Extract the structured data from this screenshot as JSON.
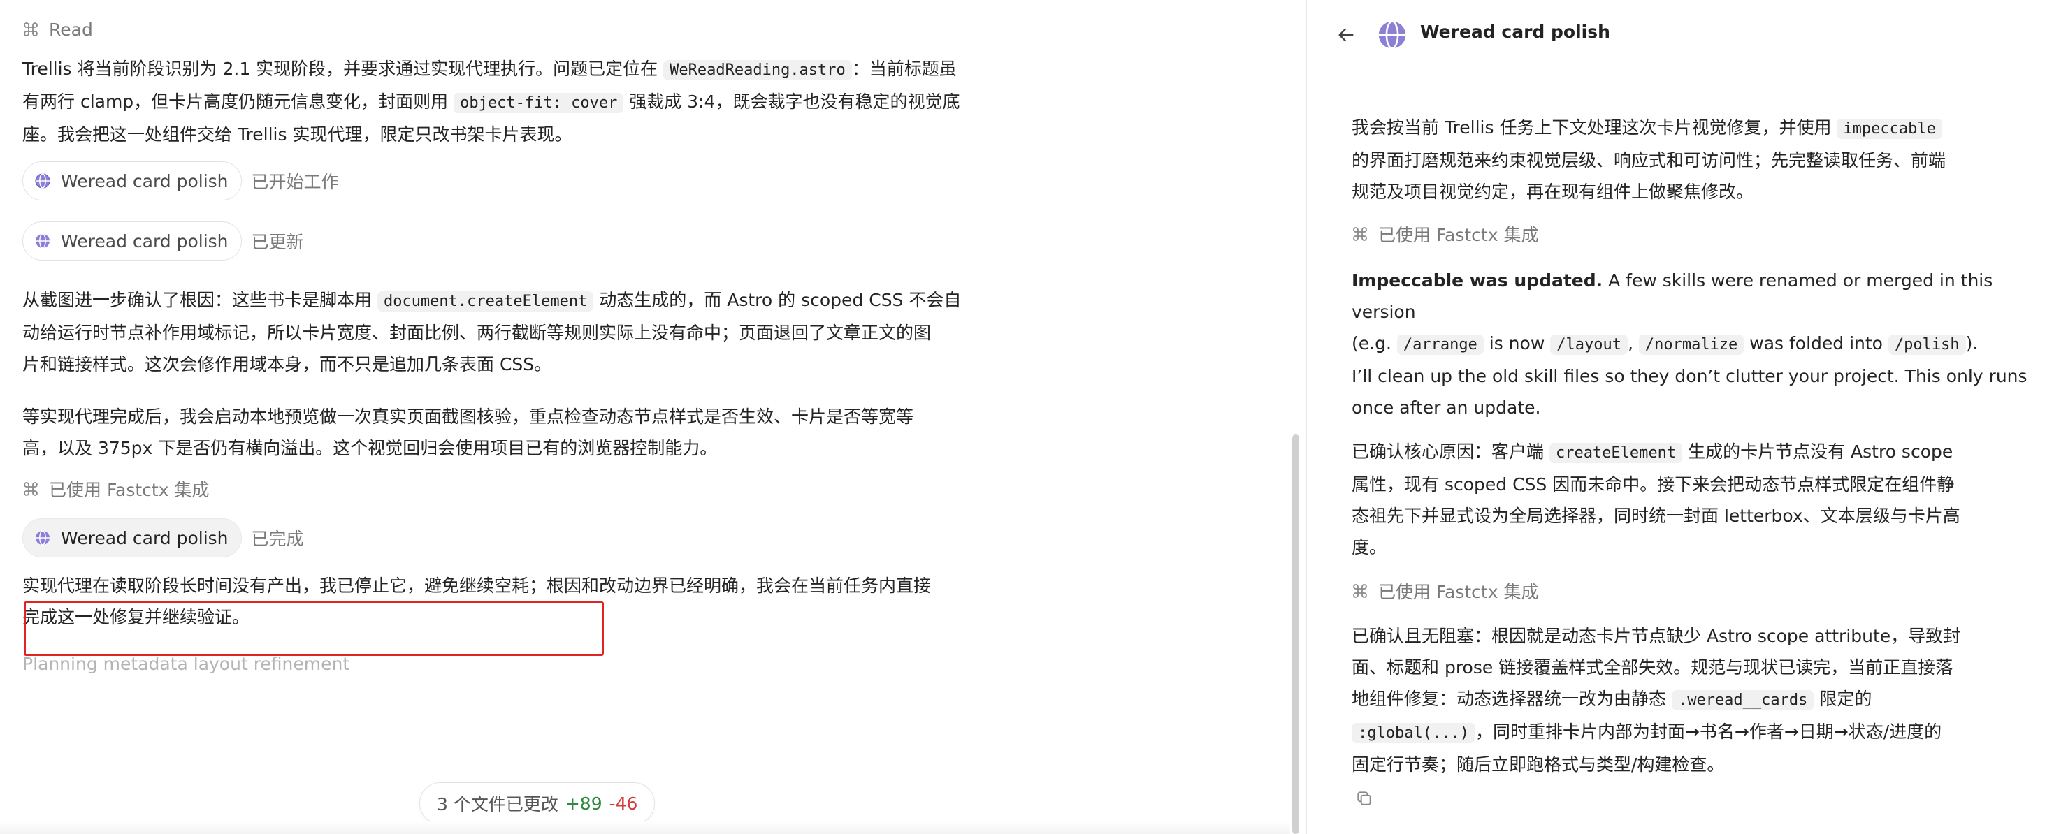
{
  "left": {
    "read_label": "Read",
    "msg1": {
      "t1": "Trellis 将当前阶段识别为 2.1 实现阶段，并要求通过实现代理执行。问题已定位在 ",
      "code1": "WeReadReading.astro",
      "t2": "：当前标题虽",
      "t3": "有两行 clamp，但卡片高度仍随元信息变化，封面则用 ",
      "code2": "object-fit: cover",
      "t4": " 强裁成 3:4，既会裁字也没有稳定的视觉底",
      "t5": "座。我会把这一处组件交给 Trellis 实现代理，限定只改书架卡片表现。"
    },
    "chip1": {
      "label": "Weread card polish",
      "status": "已开始工作"
    },
    "chip2": {
      "label": "Weread card polish",
      "status": "已更新"
    },
    "msg2": {
      "t1": "从截图进一步确认了根因：这些书卡是脚本用 ",
      "code1": "document.createElement",
      "t2": " 动态生成的，而 Astro 的 scoped CSS 不会自",
      "t3": "动给运行时节点补作用域标记，所以卡片宽度、封面比例、两行截断等规则实际上没有命中；页面退回了文章正文的图",
      "t4": "片和链接样式。这次会修作用域本身，而不只是追加几条表面 CSS。"
    },
    "msg3": {
      "t1": "等实现代理完成后，我会启动本地预览做一次真实页面截图核验，重点检查动态节点样式是否生效、卡片是否等宽等",
      "t2": "高，以及 375px 下是否仍有横向溢出。这个视觉回归会使用项目已有的浏览器控制能力。"
    },
    "tool_used": "已使用 Fastctx 集成",
    "chip3": {
      "label": "Weread card polish",
      "status": "已完成"
    },
    "msg4": {
      "t1": "实现代理在读取阶段长时间没有产出，我已停止它，避免继续空耗；",
      "t2": "根因和改动边界已经明确，我会在当前任务内直接",
      "t3": "完成这一处修复并继续验证。"
    },
    "thinking": "Planning metadata layout refinement",
    "changes": {
      "label": "3 个文件已更改",
      "plus": "+89",
      "minus": "-46"
    }
  },
  "right": {
    "title": "Weread card polish",
    "msg1": {
      "t1": "我会按当前 Trellis 任务上下文处理这次卡片视觉修复，并使用 ",
      "code1": "impeccable",
      "t2": "的界面打磨规范来约束视觉层级、响应式和可访问性；先完整读取任务、前端",
      "t3": "规范及项目视觉约定，再在现有组件上做聚焦修改。"
    },
    "tool_used_1": "已使用 Fastctx 集成",
    "msg2": {
      "bold": "Impeccable was updated.",
      "t1": " A few skills were renamed or merged in this version",
      "t2": "(e.g. ",
      "code1": "/arrange",
      "t3": " is now ",
      "code2": "/layout",
      "t4": ", ",
      "code3": "/normalize",
      "t5": " was folded into ",
      "code4": "/polish",
      "t6": ").",
      "t7": "I’ll clean up the old skill files so they don’t clutter your project. This only runs",
      "t8": "once after an update."
    },
    "msg3": {
      "t1": "已确认核心原因：客户端 ",
      "code1": "createElement",
      "t2": " 生成的卡片节点没有 Astro scope",
      "t3": "属性，现有 scoped CSS 因而未命中。接下来会把动态节点样式限定在组件静",
      "t4": "态祖先下并显式设为全局选择器，同时统一封面 letterbox、文本层级与卡片高",
      "t5": "度。"
    },
    "tool_used_2": "已使用 Fastctx 集成",
    "msg4": {
      "t1": "已确认且无阻塞：根因就是动态卡片节点缺少 Astro scope attribute，导致封",
      "t2": "面、标题和 prose 链接覆盖样式全部失效。规范与现状已读完，当前正直接落",
      "t3": "地组件修复：动态选择器统一改为由静态 ",
      "code1": ".weread__cards",
      "t4": " 限定的",
      "code2": ":global(...)",
      "t5": "，同时重排卡片内部为封面→书名→作者→日期→状态/进度的",
      "t6": "固定行节奏；随后立即跑格式与类型/构建检查。"
    }
  }
}
